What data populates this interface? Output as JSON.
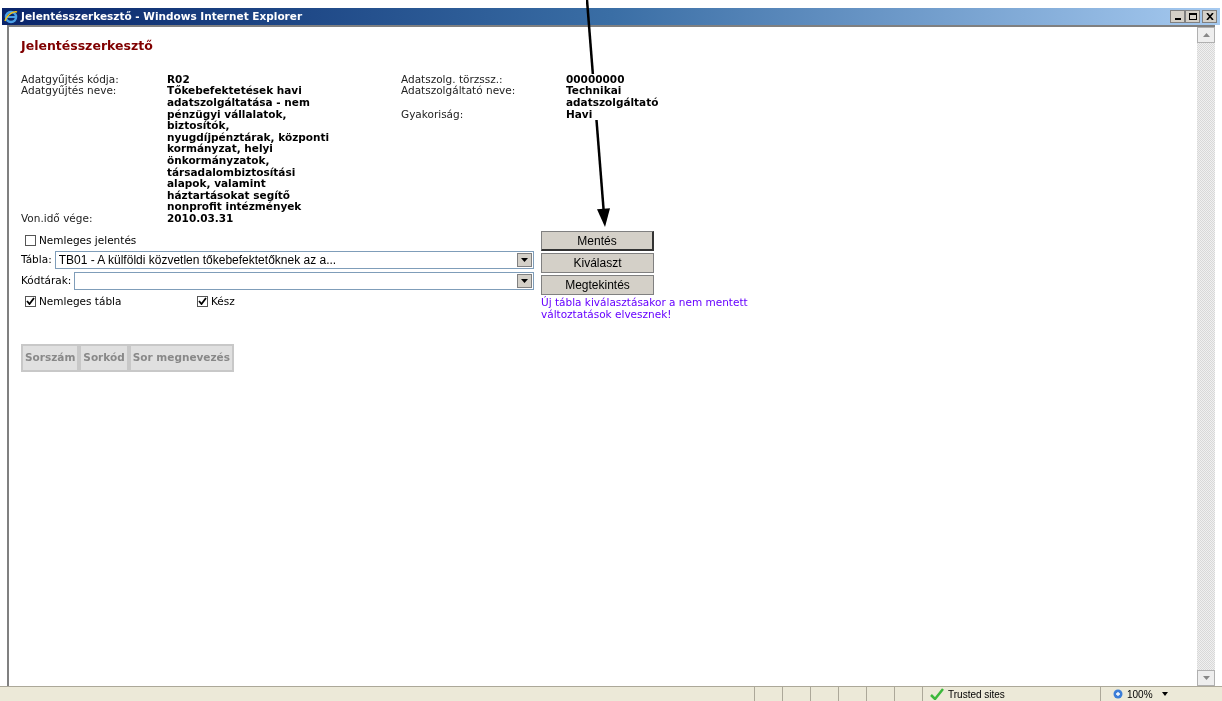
{
  "window": {
    "title": "Jelentésszerkesztő - Windows Internet Explorer"
  },
  "page": {
    "heading": "Jelentésszerkesztő",
    "info_left": [
      {
        "label": "Adatgyűjtés kódja:",
        "value": "R02"
      },
      {
        "label": "Adatgyűjtés neve:",
        "value": "Tőkebefektetések havi adatszolgáltatása - nem pénzügyi vállalatok, biztosítók, nyugdíjpénztárak, központi kormányzat, helyi önkormányzatok, társadalombiztosítási alapok, valamint háztartásokat segítő nonprofit intézmények"
      },
      {
        "label": "Von.idő vége:",
        "value": "2010.03.31"
      }
    ],
    "info_right": [
      {
        "label": "Adatszolg. törzssz.:",
        "value": "00000000"
      },
      {
        "label": "Adatszolgáltató neve:",
        "value": "Technikai adatszolgáltató"
      },
      {
        "label": "Gyakoriság:",
        "value": "Havi"
      }
    ],
    "null_report": {
      "label": "Nemleges jelentés",
      "checked": false
    },
    "table_select": {
      "label": "Tábla:",
      "value": "TB01 - A külföldi közvetlen tőkebefektetőknek az a..."
    },
    "codelist_select": {
      "label": "Kódtárak:"
    },
    "checkboxes": [
      {
        "label": "Nemleges tábla",
        "checked": true
      },
      {
        "label": "Kész",
        "checked": true
      }
    ],
    "buttons": [
      "Mentés",
      "Kiválaszt",
      "Megtekintés"
    ],
    "note": "Új tábla kiválasztásakor a nem mentett változtatások elvesznek!",
    "columns": [
      "Sorszám",
      "Sorkód",
      "Sor megnevezés"
    ]
  },
  "status_bar": {
    "zone": "Trusted sites",
    "zoom": "100%"
  }
}
